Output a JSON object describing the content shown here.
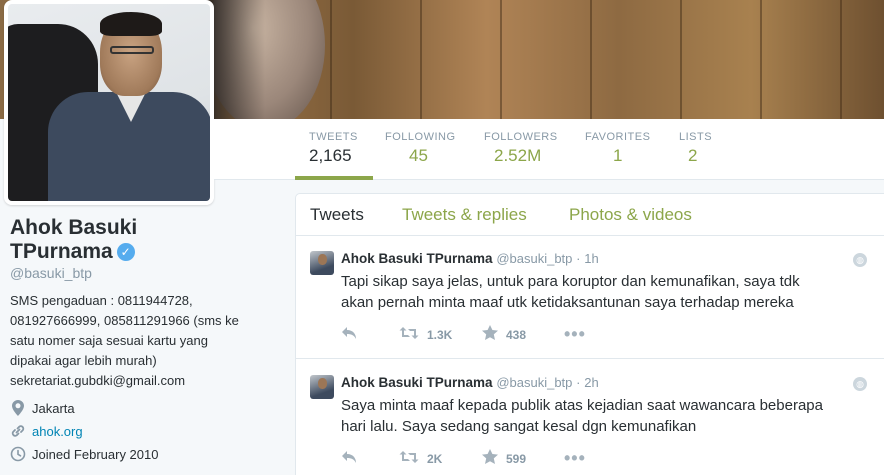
{
  "profile": {
    "name_line1": "Ahok Basuki",
    "name_line2": "TPurnama",
    "handle": "@basuki_btp",
    "bio_lines": [
      "SMS pengaduan : 0811944728,",
      "081927666999, 085811291966 (sms ke",
      "satu nomer saja sesuai kartu yang",
      "dipakai agar lebih murah)",
      "sekretariat.gubdki@gmail.com"
    ],
    "location": "Jakarta",
    "website": "ahok.org",
    "joined": "Joined February 2010",
    "icons": {
      "location": "location-pin-icon",
      "website": "link-icon",
      "joined": "calendar-icon",
      "verified": "verified-badge-icon"
    }
  },
  "stats": [
    {
      "label": "TWEETS",
      "value": "2,165"
    },
    {
      "label": "FOLLOWING",
      "value": "45"
    },
    {
      "label": "FOLLOWERS",
      "value": "2.52M"
    },
    {
      "label": "FAVORITES",
      "value": "1"
    },
    {
      "label": "LISTS",
      "value": "2"
    }
  ],
  "tabs": [
    "Tweets",
    "Tweets & replies",
    "Photos & videos"
  ],
  "tweets": [
    {
      "name": "Ahok Basuki TPurnama",
      "handle": "@basuki_btp",
      "dot": "·",
      "time": "1h",
      "lines": [
        "Tapi sikap saya jelas, untuk para koruptor dan kemunafikan, saya tdk",
        "akan pernah minta maaf utk ketidaksantunan saya terhadap mereka"
      ],
      "retweets": "1.3K",
      "favorites": "438"
    },
    {
      "name": "Ahok Basuki TPurnama",
      "handle": "@basuki_btp",
      "dot": "·",
      "time": "2h",
      "lines": [
        "Saya minta maaf kepada publik atas kejadian saat wawancara beberapa",
        "hari lalu. Saya sedang sangat kesal dgn kemunafikan"
      ],
      "retweets": "2K",
      "favorites": "599"
    }
  ],
  "colors": {
    "accent": "#8ca64a",
    "link": "#0084b4",
    "muted": "#8899a6",
    "verified": "#55acee"
  }
}
